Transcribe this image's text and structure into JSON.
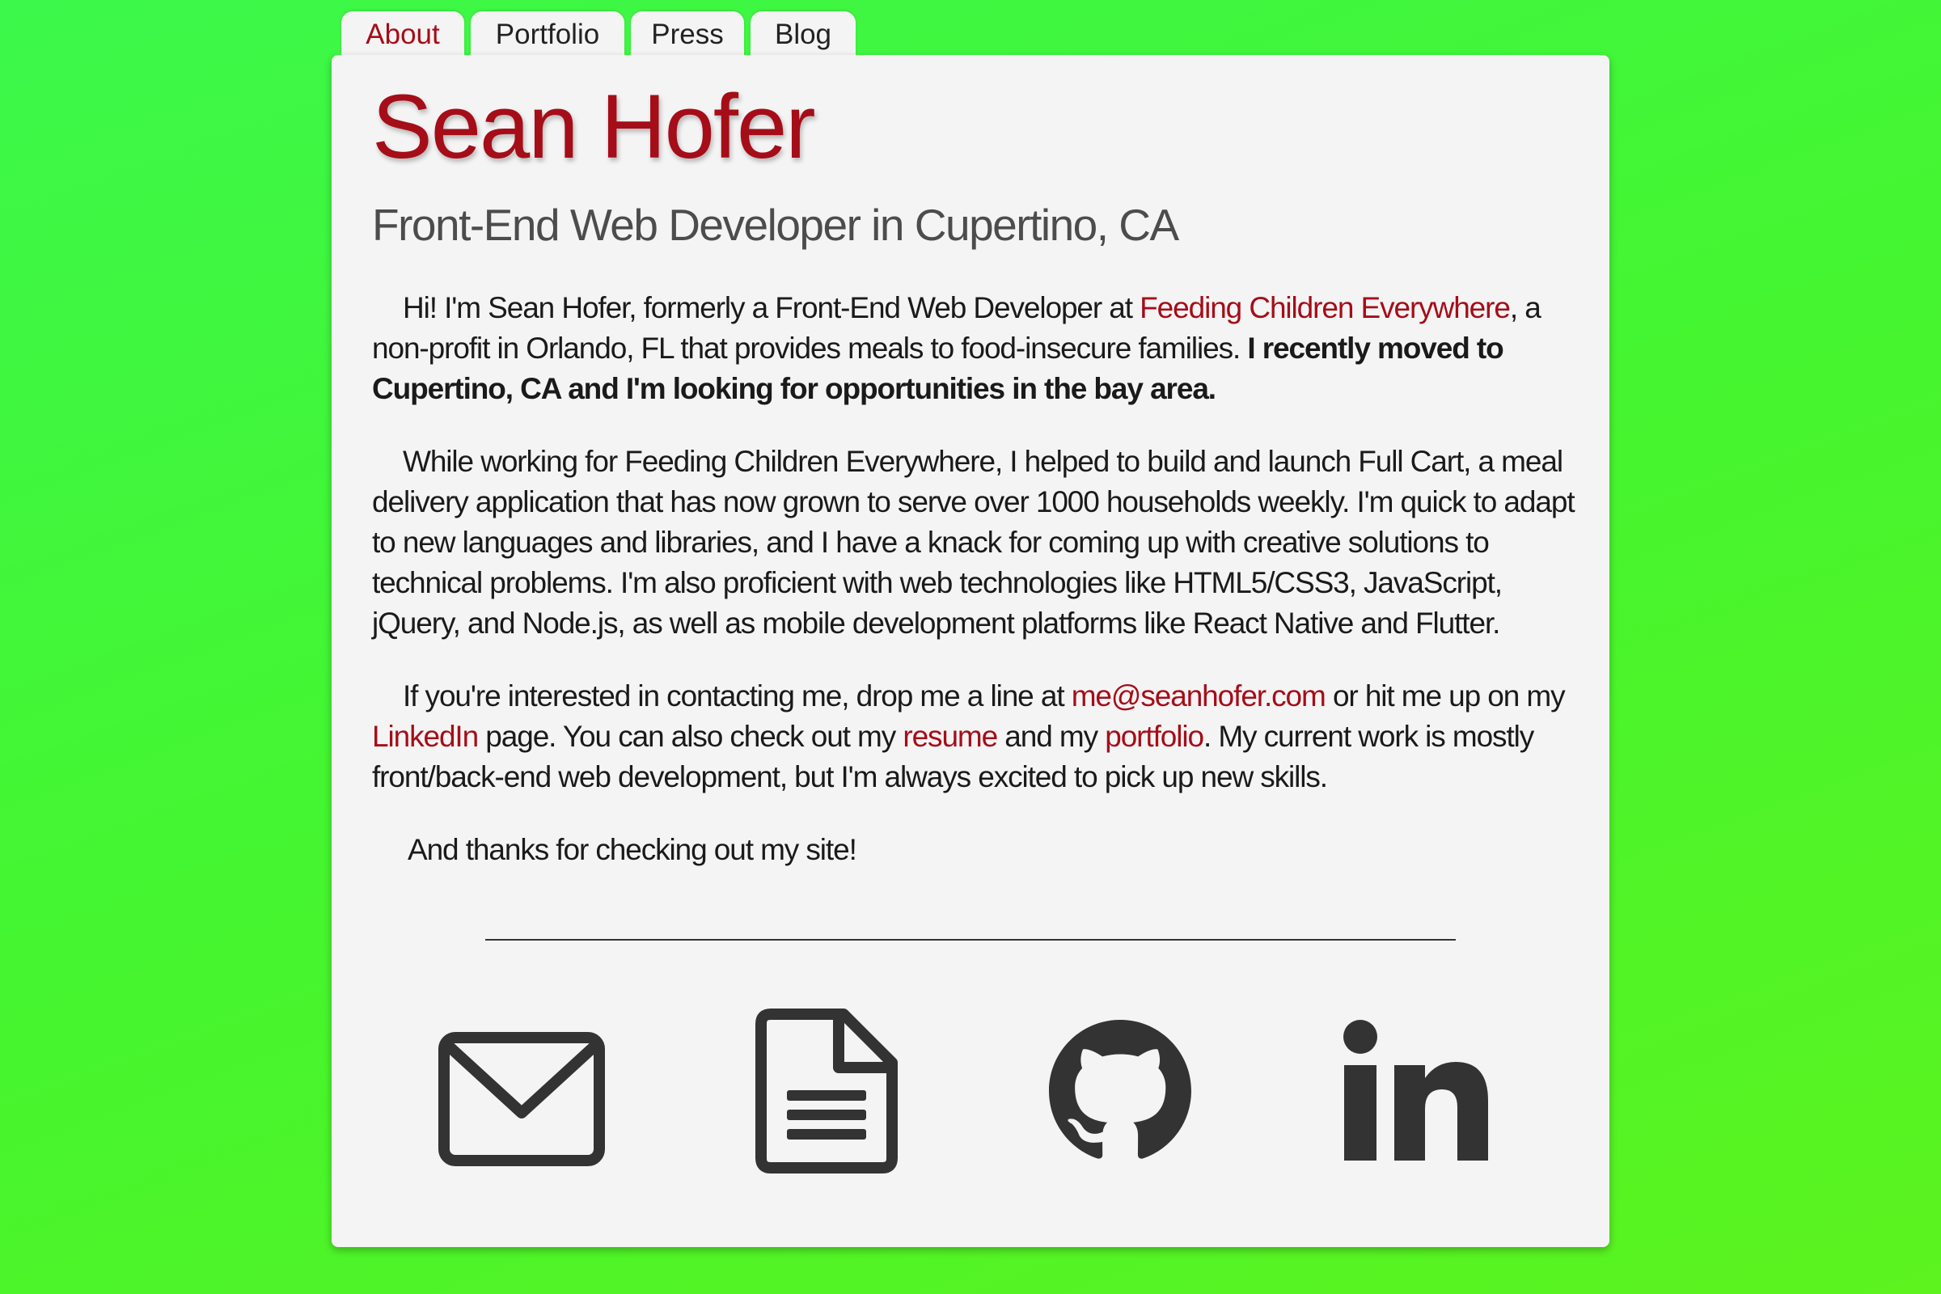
{
  "nav": {
    "tabs": [
      {
        "label": "About",
        "active": true
      },
      {
        "label": "Portfolio",
        "active": false
      },
      {
        "label": "Press",
        "active": false
      },
      {
        "label": "Blog",
        "active": false
      }
    ]
  },
  "header": {
    "name": "Sean Hofer",
    "subtitle": "Front-End Web Developer in Cupertino, CA"
  },
  "intro": {
    "p1_a": "Hi! I'm Sean Hofer, formerly a Front-End Web Developer at ",
    "p1_link": "Feeding Children Everywhere",
    "p1_b": ", a non-profit in Orlando, FL that provides meals to food-insecure families. ",
    "p1_bold": "I recently moved to Cupertino, CA and I'm looking for opportunities in the bay area.",
    "p2": "While working for Feeding Children Everywhere, I helped to build and launch Full Cart, a meal delivery application that has now grown to serve over 1000 households weekly. I'm quick to adapt to new languages and libraries, and I have a knack for coming up with creative solutions to technical problems. I'm also proficient with web technologies like HTML5/CSS3, JavaScript, jQuery, and Node.js, as well as mobile development platforms like React Native and Flutter.",
    "p3_a": "If you're interested in contacting me, drop me a line at ",
    "p3_email": "me@seanhofer.com",
    "p3_b": " or hit me up on my ",
    "p3_linkedin": "LinkedIn",
    "p3_c": " page. You can also check out my ",
    "p3_resume": "resume",
    "p3_d": " and my ",
    "p3_portfolio": "portfolio",
    "p3_e": ". My current work is mostly front/back-end web development, but I'm always excited to pick up new skills.",
    "p4": "And thanks for checking out my site!"
  },
  "social_icons": [
    {
      "icon": "envelope-icon"
    },
    {
      "icon": "document-icon"
    },
    {
      "icon": "github-icon"
    },
    {
      "icon": "linkedin-icon"
    }
  ],
  "colors": {
    "accent": "#a50d18",
    "card_background": "#f4f4f4",
    "page_background": "#45f52f",
    "icon_color": "#333333"
  }
}
